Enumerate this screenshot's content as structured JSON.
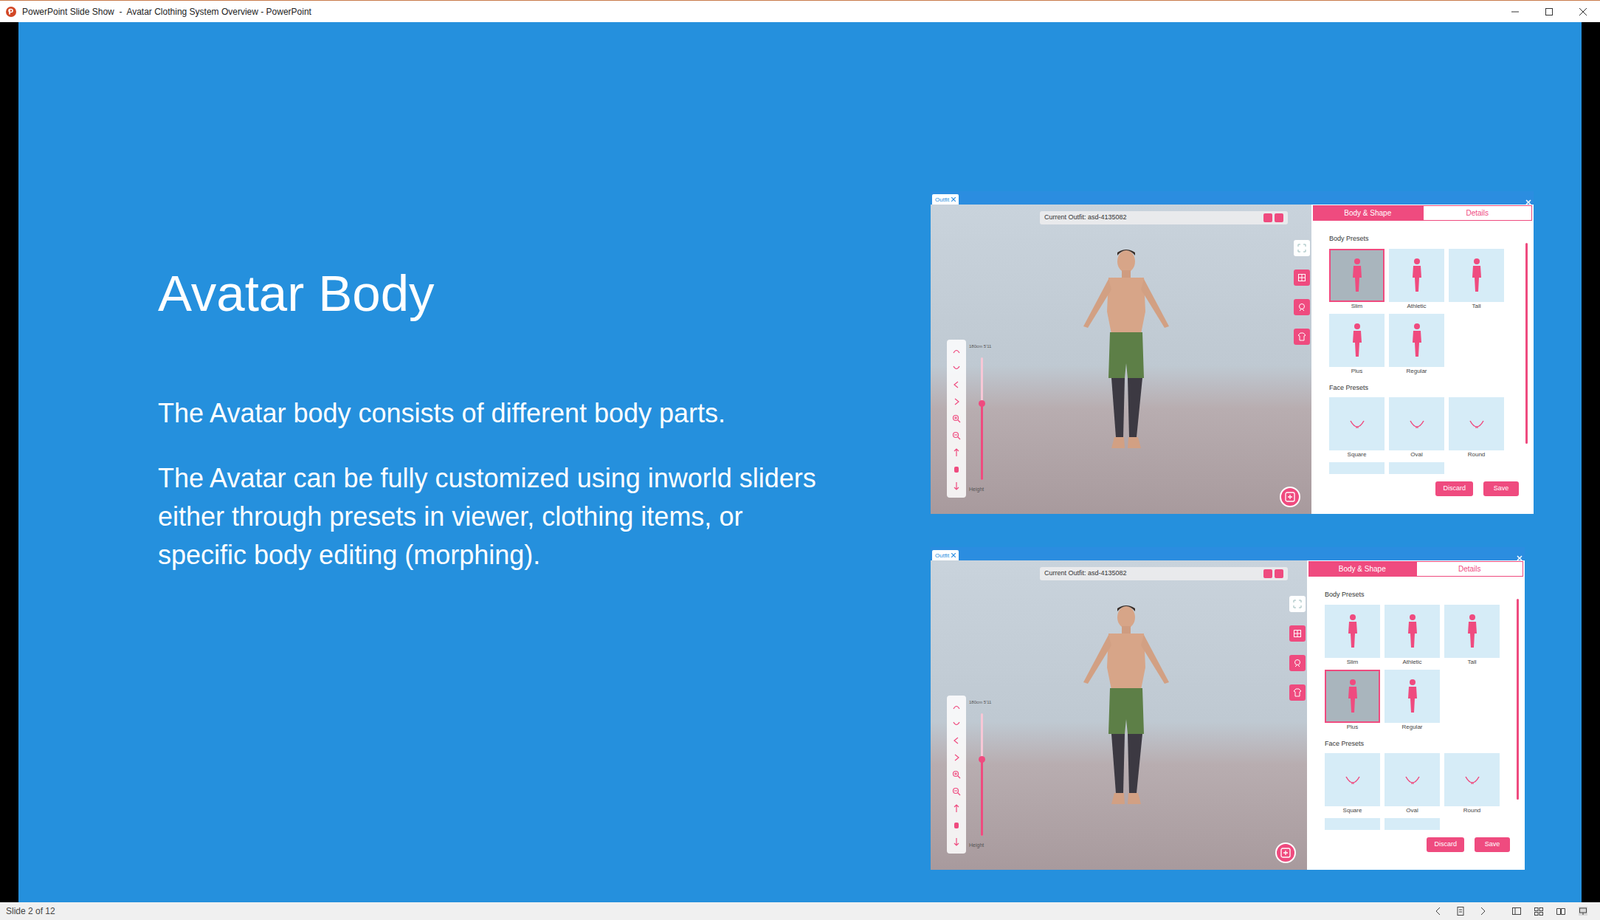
{
  "window": {
    "title": "PowerPoint Slide Show  -  Avatar Clothing System Overview - PowerPoint"
  },
  "slide": {
    "title": "Avatar Body",
    "paragraphs": [
      "The Avatar body consists of different body parts.",
      "The Avatar can be fully customized using inworld sliders either through presets in viewer, clothing items, or specific body editing (morphing)."
    ]
  },
  "screenshots": [
    {
      "tab_label": "Outfit",
      "current_outfit": "Current Outfit: asd-4135082",
      "height_reading": "180cm 5'11",
      "height_label": "Height",
      "height_level": 0.62,
      "tabs": [
        {
          "label": "Body & Shape",
          "selected": true
        },
        {
          "label": "Details",
          "selected": false
        }
      ],
      "body_presets_title": "Body Presets",
      "body_presets": [
        {
          "label": "Slim",
          "selected": true
        },
        {
          "label": "Athletic",
          "selected": false
        },
        {
          "label": "Tall",
          "selected": false
        },
        {
          "label": "Plus",
          "selected": false
        },
        {
          "label": "Regular",
          "selected": false
        }
      ],
      "face_presets_title": "Face Presets",
      "face_presets": [
        {
          "label": "Square"
        },
        {
          "label": "Oval"
        },
        {
          "label": "Round"
        }
      ],
      "buttons": [
        "Discard",
        "Save"
      ]
    },
    {
      "tab_label": "Outfit",
      "current_outfit": "Current Outfit: asd-4135082",
      "height_reading": "180cm 5'11",
      "height_label": "Height",
      "height_level": 0.62,
      "tabs": [
        {
          "label": "Body & Shape",
          "selected": true
        },
        {
          "label": "Details",
          "selected": false
        }
      ],
      "body_presets_title": "Body Presets",
      "body_presets": [
        {
          "label": "Slim",
          "selected": false
        },
        {
          "label": "Athletic",
          "selected": false
        },
        {
          "label": "Tall",
          "selected": false
        },
        {
          "label": "Plus",
          "selected": true
        },
        {
          "label": "Regular",
          "selected": false
        }
      ],
      "face_presets_title": "Face Presets",
      "face_presets": [
        {
          "label": "Square"
        },
        {
          "label": "Oval"
        },
        {
          "label": "Round"
        }
      ],
      "buttons": [
        "Discard",
        "Save"
      ]
    }
  ],
  "status_bar": {
    "text": "Slide 2 of 12"
  }
}
